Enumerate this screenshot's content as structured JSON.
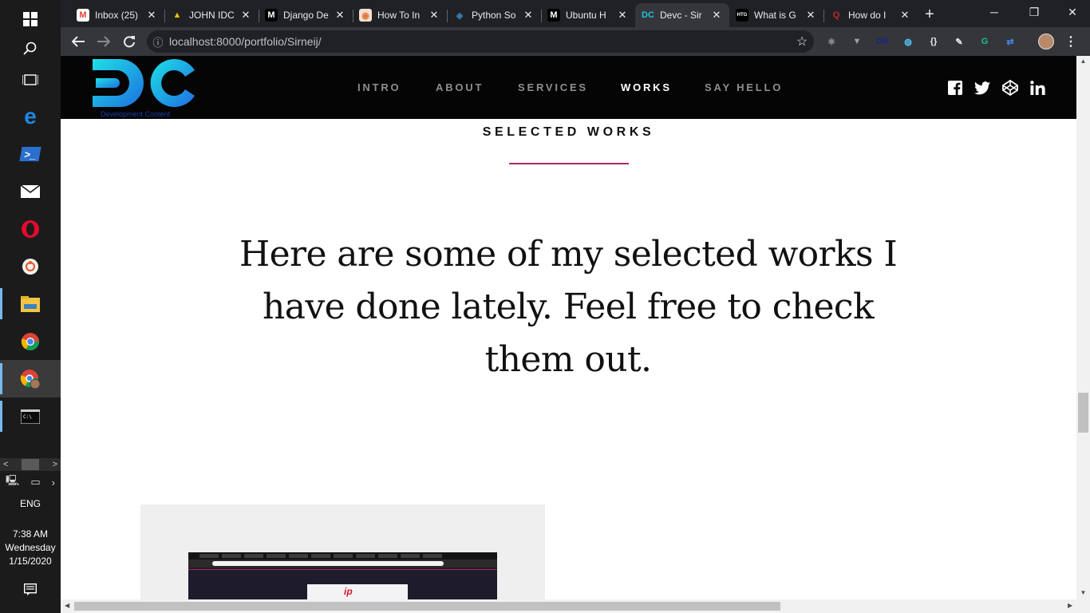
{
  "taskbar": {
    "apps": [
      {
        "name": "start",
        "glyph": "⊞"
      },
      {
        "name": "search",
        "glyph": "⌕"
      },
      {
        "name": "task-view",
        "glyph": "⧉"
      },
      {
        "name": "edge",
        "glyph": "e"
      },
      {
        "name": "powershell",
        "glyph": "≥"
      },
      {
        "name": "mail",
        "glyph": "✉"
      },
      {
        "name": "opera",
        "glyph": "O"
      },
      {
        "name": "ubuntu",
        "glyph": "◉"
      },
      {
        "name": "file-explorer",
        "glyph": "▭"
      },
      {
        "name": "chrome",
        "glyph": "◎"
      },
      {
        "name": "chrome-profile",
        "glyph": "◎"
      },
      {
        "name": "terminal",
        "glyph": "▣"
      }
    ],
    "language": "ENG",
    "time": "7:38 AM",
    "day": "Wednesday",
    "date": "1/15/2020"
  },
  "browser": {
    "tabs": [
      {
        "title": "Inbox (25)",
        "favicon": "M",
        "fav_color": "#ea4335",
        "fav_bg": "#ffffff"
      },
      {
        "title": "JOHN IDC",
        "favicon": "▲",
        "fav_color": "#fbbc04",
        "fav_bg": "transparent"
      },
      {
        "title": "Django De",
        "favicon": "M",
        "fav_color": "#ffffff",
        "fav_bg": "#000000"
      },
      {
        "title": "How To In",
        "favicon": "◉",
        "fav_color": "#e07a3b",
        "fav_bg": "#f4e0d0"
      },
      {
        "title": "Python So",
        "favicon": "◆",
        "fav_color": "#3776ab",
        "fav_bg": "transparent"
      },
      {
        "title": "Ubuntu H",
        "favicon": "M",
        "fav_color": "#ffffff",
        "fav_bg": "#000000"
      },
      {
        "title": "Devc - Sir",
        "favicon": "DC",
        "fav_color": "#21c1e0",
        "fav_bg": "transparent"
      },
      {
        "title": "What is G",
        "favicon": "HTG",
        "fav_color": "#ffffff",
        "fav_bg": "#000000"
      },
      {
        "title": "How do I",
        "favicon": "Q",
        "fav_color": "#b92b27",
        "fav_bg": "transparent"
      }
    ],
    "active_tab": 6,
    "new_tab_label": "+",
    "url": "localhost:8000/portfolio/Sirneij/",
    "extensions": [
      {
        "name": "react-devtools",
        "glyph": "⚛",
        "color": "#9aa0a6"
      },
      {
        "name": "vue-devtools",
        "glyph": "▼",
        "color": "#9aa0a6"
      },
      {
        "name": "dark-reader",
        "glyph": "DR",
        "color": "#1a237e"
      },
      {
        "name": "chat-ext",
        "glyph": "◍",
        "color": "#4fc3f7"
      },
      {
        "name": "json-viewer",
        "glyph": "{}",
        "color": "#e8eaed"
      },
      {
        "name": "color-picker",
        "glyph": "✎",
        "color": "#e8eaed"
      },
      {
        "name": "grammarly",
        "glyph": "G",
        "color": "#15c39a"
      },
      {
        "name": "link-ext",
        "glyph": "⇄",
        "color": "#4285f4"
      }
    ]
  },
  "site": {
    "logo_text": "Development Content",
    "nav": [
      "INTRO",
      "ABOUT",
      "SERVICES",
      "WORKS",
      "SAY HELLO"
    ],
    "current_nav": "WORKS",
    "social": [
      "facebook",
      "twitter",
      "codepen",
      "linkedin"
    ],
    "section_title": "SELECTED WORKS",
    "lead": "Here are some of my selected works I have done lately. Feel free to check them out.",
    "accent_color": "#b0246a"
  }
}
